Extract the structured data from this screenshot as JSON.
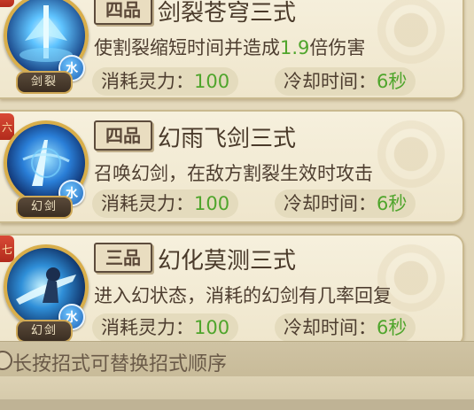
{
  "skills": [
    {
      "rank": "四品",
      "name": "剑裂苍穹三式",
      "desc_before": "使割裂缩短时间并造成",
      "desc_highlight": "1.9",
      "desc_after": "倍伤害",
      "cost_label": "消耗灵力：",
      "cost_value": "100",
      "cooldown_label": "冷却时间：",
      "cooldown_value": "6秒",
      "icon_label": "剑裂",
      "element": "水",
      "side_tab": "",
      "icon": "sword-split-sky-icon"
    },
    {
      "rank": "四品",
      "name": "幻雨飞剑三式",
      "desc": "召唤幻剑，在敌方割裂生效时攻击",
      "cost_label": "消耗灵力：",
      "cost_value": "100",
      "cooldown_label": "冷却时间：",
      "cooldown_value": "6秒",
      "icon_label": "幻剑",
      "element": "水",
      "side_tab": "六",
      "icon": "phantom-flying-sword-icon"
    },
    {
      "rank": "三品",
      "name": "幻化莫测三式",
      "desc": "进入幻状态，消耗的幻剑有几率回复",
      "cost_label": "消耗灵力：",
      "cost_value": "100",
      "cooldown_label": "冷却时间：",
      "cooldown_value": "6秒",
      "icon_label": "幻剑",
      "element": "水",
      "side_tab": "七",
      "icon": "illusion-transform-icon"
    }
  ],
  "footer": {
    "hint": "长按招式可替换招式顺序"
  },
  "colors": {
    "highlight_green": "#4fa52c",
    "text_brown": "#4e3e30",
    "water_blue": "#1f63b8"
  }
}
